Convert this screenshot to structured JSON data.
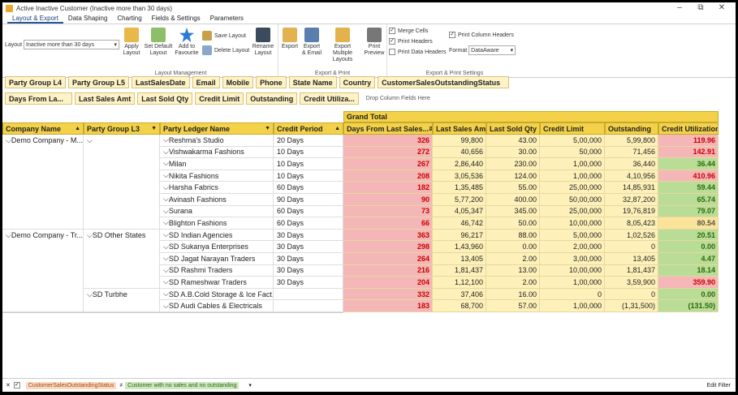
{
  "window": {
    "title": "Active Inactive Customer (Inactive more than 30 days)",
    "controls": [
      "–",
      "⧉",
      "✕"
    ]
  },
  "tabs": [
    "Layout & Export",
    "Data Shaping",
    "Charting",
    "Fields & Settings",
    "Parameters"
  ],
  "ribbon": {
    "layout_label": "Layout",
    "layout_value": "Inactive more than 30 days",
    "layout_mgmt": {
      "group": "Layout Management",
      "apply": "Apply Layout",
      "set_default": "Set Default Layout",
      "favourite": "Add to Favourite",
      "save": "Save Layout",
      "delete": "Delete Layout",
      "rename": "Rename Layout"
    },
    "export": {
      "group": "Export & Print",
      "export": "Export",
      "export_email": "Export & Email",
      "export_multi": "Export Multiple Layouts",
      "print_preview": "Print Preview"
    },
    "print_settings": {
      "group": "Export & Print Settings",
      "merge_cells": "Merge Cells",
      "print_headers": "Print Headers",
      "print_data_headers": "Print Data Headers",
      "print_column_headers": "Print Column Headers",
      "format_label": "Format",
      "format_value": "DataAware"
    }
  },
  "filter_fields": [
    "Party Group L4",
    "Party Group L5",
    "LastSalesDate",
    "Email",
    "Mobile",
    "Phone",
    "State Name",
    "Country",
    "CustomerSalesOutstandingStatus"
  ],
  "data_fields": [
    "Days From La...",
    "Last Sales Amt",
    "Last Sold Qty",
    "Credit Limit",
    "Outstanding",
    "Credit Utiliza..."
  ],
  "drop_hint": "Drop Column Fields Here",
  "grand_total": "Grand Total",
  "row_headers": [
    "Company Name",
    "Party Group L3",
    "Party Ledger Name",
    "Credit Period"
  ],
  "col_headers": [
    "Days From Last Sales...",
    "Last Sales Amt",
    "Last Sold Qty",
    "Credit Limit",
    "Outstanding",
    "Credit Utilization"
  ],
  "groups": [
    {
      "company": "Demo Company - M...",
      "l3": "",
      "rows": 8
    },
    {
      "company": "Demo Company - Tr...",
      "l3": "SD Other States",
      "rows": 5
    },
    {
      "company": "",
      "l3": "SD Turbhe",
      "rows": 2
    }
  ],
  "rows": [
    {
      "ledger": "Reshma's Studio",
      "period": "20 Days",
      "days": "326",
      "amt": "99,800",
      "qty": "43.00",
      "limit": "5,00,000",
      "out": "5,99,800",
      "util": "119.96",
      "uc": "r"
    },
    {
      "ledger": "Vishwakarma Fashions",
      "period": "10 Days",
      "days": "272",
      "amt": "40,656",
      "qty": "30.00",
      "limit": "50,000",
      "out": "71,456",
      "util": "142.91",
      "uc": "r"
    },
    {
      "ledger": "Milan",
      "period": "10 Days",
      "days": "267",
      "amt": "2,86,440",
      "qty": "230.00",
      "limit": "1,00,000",
      "out": "36,440",
      "util": "36.44",
      "uc": "g"
    },
    {
      "ledger": "Nikita Fashions",
      "period": "10 Days",
      "days": "208",
      "amt": "3,05,536",
      "qty": "124.00",
      "limit": "1,00,000",
      "out": "4,10,956",
      "util": "410.96",
      "uc": "r"
    },
    {
      "ledger": "Harsha Fabrics",
      "period": "60 Days",
      "days": "182",
      "amt": "1,35,485",
      "qty": "55.00",
      "limit": "25,00,000",
      "out": "14,85,931",
      "util": "59.44",
      "uc": "g"
    },
    {
      "ledger": "Avinash Fashions",
      "period": "90 Days",
      "days": "90",
      "amt": "5,77,200",
      "qty": "400.00",
      "limit": "50,00,000",
      "out": "32,87,200",
      "util": "65.74",
      "uc": "g"
    },
    {
      "ledger": "Surana",
      "period": "60 Days",
      "days": "73",
      "amt": "4,05,347",
      "qty": "345.00",
      "limit": "25,00,000",
      "out": "19,76,819",
      "util": "79.07",
      "uc": "g"
    },
    {
      "ledger": "Blighton Fashions",
      "period": "60 Days",
      "days": "66",
      "amt": "46,742",
      "qty": "50.00",
      "limit": "10,00,000",
      "out": "8,05,423",
      "util": "80.54",
      "uc": "yb"
    },
    {
      "ledger": "SD Indian Agencies",
      "period": "30 Days",
      "days": "363",
      "amt": "96,217",
      "qty": "88.00",
      "limit": "5,00,000",
      "out": "1,02,526",
      "util": "20.51",
      "uc": "g"
    },
    {
      "ledger": "SD Sukanya Enterprises",
      "period": "30 Days",
      "days": "298",
      "amt": "1,43,960",
      "qty": "0.00",
      "limit": "2,00,000",
      "out": "0",
      "util": "0.00",
      "uc": "g"
    },
    {
      "ledger": "SD Jagat Narayan Traders",
      "period": "30 Days",
      "days": "264",
      "amt": "13,405",
      "qty": "2.00",
      "limit": "3,00,000",
      "out": "13,405",
      "util": "4.47",
      "uc": "g"
    },
    {
      "ledger": "SD Rashmi Traders",
      "period": "30 Days",
      "days": "216",
      "amt": "1,81,437",
      "qty": "13.00",
      "limit": "10,00,000",
      "out": "1,81,437",
      "util": "18.14",
      "uc": "g"
    },
    {
      "ledger": "SD Rameshwar Traders",
      "period": "30 Days",
      "days": "204",
      "amt": "1,12,100",
      "qty": "2.00",
      "limit": "1,00,000",
      "out": "3,59,900",
      "util": "359.90",
      "uc": "r"
    },
    {
      "ledger": "SD A.B.Cold Storage & Ice Fact...",
      "period": "",
      "days": "332",
      "amt": "37,406",
      "qty": "16.00",
      "limit": "0",
      "out": "0",
      "util": "0.00",
      "uc": "g"
    },
    {
      "ledger": "SD Audi Cables & Electricals",
      "period": "",
      "days": "183",
      "amt": "68,700",
      "qty": "57.00",
      "limit": "1,00,000",
      "out": "(1,31,500)",
      "util": "(131.50)",
      "uc": "g"
    }
  ],
  "status": {
    "filter1": "CustomerSalesOutstandingStatus",
    "op": "≠",
    "filter2": "Customer with no sales and no outstanding",
    "edit": "Edit Filter"
  },
  "colors": {
    "header": "#f3d24a",
    "cell": "#fdf0b8",
    "red": "#f4b6b6",
    "green": "#b9dc97"
  }
}
